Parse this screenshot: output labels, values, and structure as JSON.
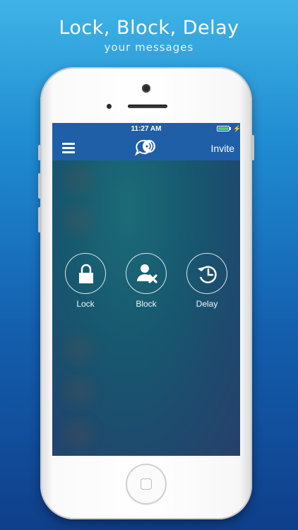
{
  "promo": {
    "headline": "Lock, Block, Delay",
    "subline": "your messages"
  },
  "status_bar": {
    "time": "11:27 AM",
    "battery_level": 1.0,
    "battery_color": "#4cd964",
    "charging_glyph": "⚡"
  },
  "nav_bar": {
    "menu_icon": "hamburger-icon",
    "logo_icon": "chat-bubbles-signal-icon",
    "invite_label": "Invite",
    "background": "#1f5fa8"
  },
  "actions": [
    {
      "label": "Lock",
      "icon": "padlock-icon"
    },
    {
      "label": "Block",
      "icon": "user-block-icon"
    },
    {
      "label": "Delay",
      "icon": "clock-history-icon"
    }
  ],
  "colors": {
    "page_gradient_top": "#3fb3e6",
    "page_gradient_bottom": "#0f3f8a",
    "phone_body": "#ffffff"
  }
}
